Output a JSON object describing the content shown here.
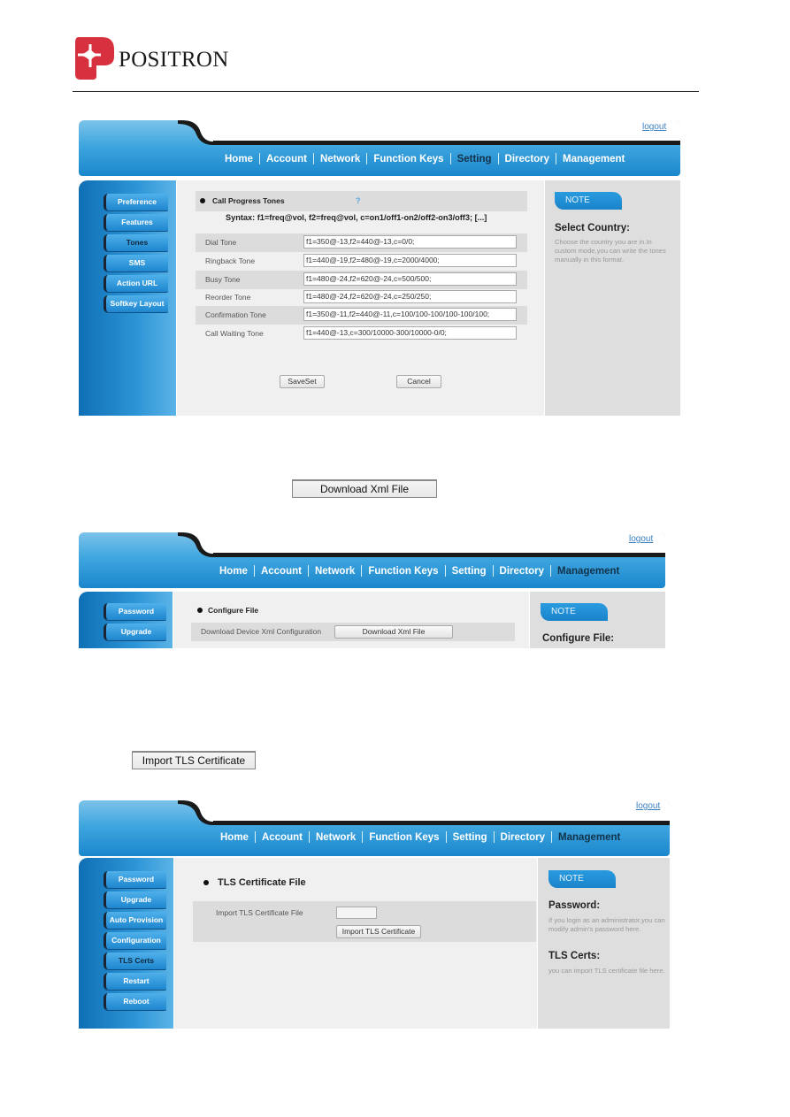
{
  "brand": {
    "name": "POSITRON",
    "logo_color": "#d7313f"
  },
  "colors": {
    "nav_blue": "#1a86cc",
    "active_nav": "#13324a",
    "note_blue": "#2a9be0"
  },
  "nav_items": [
    "Home",
    "Account",
    "Network",
    "Function Keys",
    "Setting",
    "Directory",
    "Management"
  ],
  "logout_label": "logout",
  "screen1": {
    "active_nav": "Setting",
    "sidebar": [
      "Preference",
      "Features",
      "Tones",
      "SMS",
      "Action URL",
      "Softkey Layout"
    ],
    "active_sidebar": "Tones",
    "section_title": "Call Progress Tones",
    "help_icon": "?",
    "syntax": "Syntax: f1=freq@vol, f2=freq@vol, c=on1/off1-on2/off2-on3/off3; [...]",
    "rows": [
      {
        "label": "Dial Tone",
        "value": "f1=350@-13,f2=440@-13,c=0/0;"
      },
      {
        "label": "Ringback Tone",
        "value": "f1=440@-19,f2=480@-19,c=2000/4000;"
      },
      {
        "label": "Busy Tone",
        "value": "f1=480@-24,f2=620@-24,c=500/500;"
      },
      {
        "label": "Reorder Tone",
        "value": "f1=480@-24,f2=620@-24,c=250/250;"
      },
      {
        "label": "Confirmation Tone",
        "value": "f1=350@-11,f2=440@-11,c=100/100-100/100-100/100;"
      },
      {
        "label": "Call Waiting Tone",
        "value": "f1=440@-13,c=300/10000-300/10000-0/0;"
      }
    ],
    "save_label": "SaveSet",
    "cancel_label": "Cancel",
    "note": {
      "tab": "NOTE",
      "title": "Select Country:",
      "text": "Choose the country you are in.In custom mode,you can write the tones manually in this format."
    }
  },
  "standalone_download_button": "Download Xml File",
  "screen2": {
    "active_nav": "Management",
    "sidebar": [
      "Password",
      "Upgrade"
    ],
    "section_title": "Configure File",
    "row_label": "Download Device Xml Configuration",
    "button": "Download Xml File",
    "note": {
      "tab": "NOTE",
      "title": "Configure File:"
    }
  },
  "standalone_import_button": "Import TLS Certificate",
  "screen3": {
    "active_nav": "Management",
    "sidebar": [
      "Password",
      "Upgrade",
      "Auto Provision",
      "Configuration",
      "TLS Certs",
      "Restart",
      "Reboot"
    ],
    "active_sidebar": "TLS Certs",
    "section_title": "TLS Certificate File",
    "row_label": "Import TLS Certificate File",
    "button": "Import TLS Certificate",
    "note": {
      "tab": "NOTE",
      "items": [
        {
          "title": "Password:",
          "text": "If you login as an administrator,you can modify admin's password here."
        },
        {
          "title": "TLS Certs:",
          "text": "you can import TLS certificate file here."
        }
      ]
    }
  }
}
